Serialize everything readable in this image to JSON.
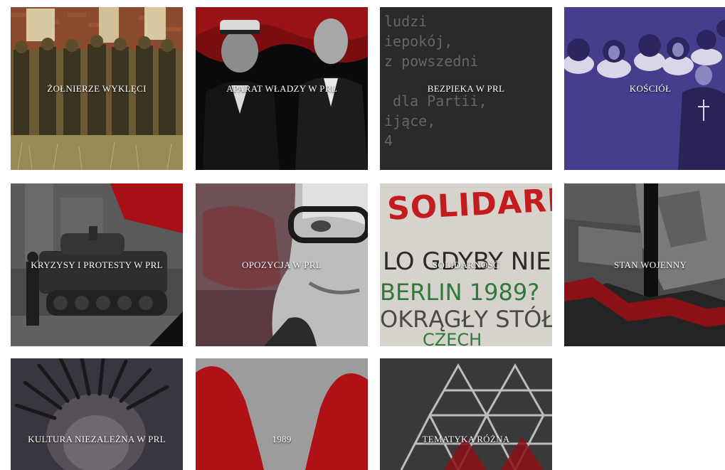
{
  "tiles": [
    {
      "label": "ŻOŁNIERZE WYKLĘCI"
    },
    {
      "label": "APARAT WŁADZY W PRL"
    },
    {
      "label": "BEZPIEKA W PRL"
    },
    {
      "label": "KOŚCIÓŁ"
    },
    {
      "label": "KRYZYSY I PROTESTY W PRL"
    },
    {
      "label": "OPOZYCJA W PRL"
    },
    {
      "label": "SOLIDARNOŚĆ"
    },
    {
      "label": "STAN WOJENNY"
    },
    {
      "label": "KULTURA NIEZALEŻNA W PRL"
    },
    {
      "label": "1989"
    },
    {
      "label": "TEMATYKA RÓŻNA"
    }
  ],
  "art_text": {
    "bezpieka": "ludzi\niepokój,\nz powszedni\n\n dla Partii,\nijące,\n4",
    "solidarnosc_1": "SOLIDARN",
    "solidarnosc_2": "LO GDYBY NIESI",
    "solidarnosc_3": "BERLIN 1989?",
    "solidarnosc_4": "OKRĄGŁY STÓŁ?",
    "solidarnosc_5": "CZECH"
  },
  "colors": {
    "accent_red": "#c0151b",
    "purple": "#4a3f8f",
    "sepia": "#7d6a3d"
  }
}
